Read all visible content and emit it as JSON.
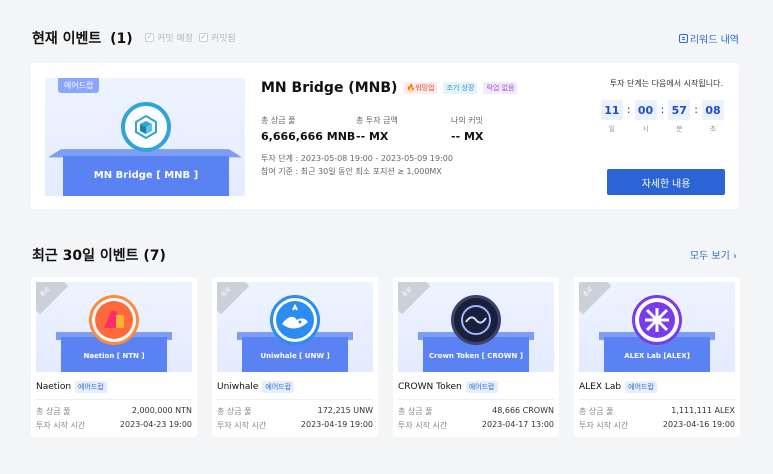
{
  "current": {
    "title": "현재 이벤트",
    "count": "(1)",
    "filter1": "커밋 예정",
    "filter2": "커밋됨",
    "reward_link": "리워드 내역",
    "event": {
      "tag": "에어드랍",
      "banner_text": "MN Bridge [ MNB ]",
      "name": "MN Bridge (MNB)",
      "pills": [
        "워밍업",
        "조기 상장",
        "락업 없음"
      ],
      "stats": [
        {
          "label": "총 상금 풀",
          "value": "6,666,666 MNB"
        },
        {
          "label": "총 투자 금액",
          "value": "-- MX"
        },
        {
          "label": "나의 커밋",
          "value": "-- MX"
        }
      ],
      "period": "투자 단계 : 2023-05-08 19:00 - 2023-05-09 19:00",
      "criteria": "참여 기준 : 최근 30일 동안 최소 포지션 ≥ 1,000MX",
      "countdown_label": "투자 단계는 다음에서 시작됩니다.",
      "countdown": [
        {
          "num": "11",
          "unit": "일"
        },
        {
          "num": "00",
          "unit": "시"
        },
        {
          "num": "57",
          "unit": "분"
        },
        {
          "num": "08",
          "unit": "초"
        }
      ],
      "detail_button": "자세한 내용"
    }
  },
  "recent": {
    "title": "최근 30일 이벤트",
    "count": "(7)",
    "all_link": "모두 보기 ›",
    "ended_label": "종료",
    "pool_label": "총 상금 풀",
    "start_label": "투자 시작 시간",
    "events": [
      {
        "banner": "Naetion [ NTN ]",
        "name": "Naetion",
        "tag": "에어드랍",
        "pool": "2,000,000 NTN",
        "start": "2023-04-23 19:00",
        "color": "#ff5a4e"
      },
      {
        "banner": "Uniwhale [ UNW ]",
        "name": "Uniwhale",
        "tag": "에어드랍",
        "pool": "172,215 UNW",
        "start": "2023-04-19 19:00",
        "color": "#2d8cf0"
      },
      {
        "banner": "Crown Token [ CROWN ]",
        "name": "CROWN Token",
        "tag": "에어드랍",
        "pool": "48,666 CROWN",
        "start": "2023-04-17 13:00",
        "color": "#1a1f3a"
      },
      {
        "banner": "ALEX Lab [ALEX]",
        "name": "ALEX Lab",
        "tag": "에어드랍",
        "pool": "1,111,111 ALEX",
        "start": "2023-04-16 19:00",
        "color": "#7a3ce8"
      }
    ]
  }
}
